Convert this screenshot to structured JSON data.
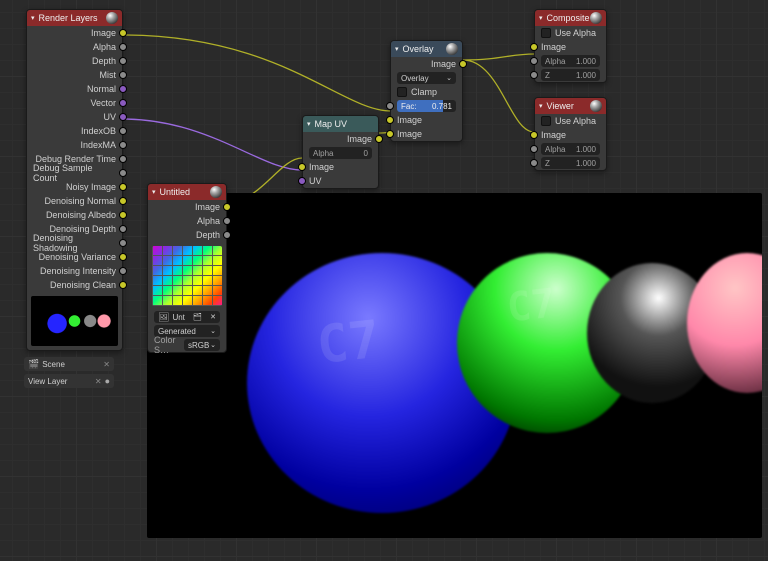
{
  "render_layers": {
    "title": "Render Layers",
    "outputs": [
      "Image",
      "Alpha",
      "Depth",
      "Mist",
      "Normal",
      "Vector",
      "UV",
      "IndexOB",
      "IndexMA",
      "Debug Render Time",
      "Debug Sample Count",
      "Noisy Image",
      "Denoising Normal",
      "Denoising Albedo",
      "Denoising Depth",
      "Denoising Shadowing",
      "Denoising Variance",
      "Denoising Intensity",
      "Denoising Clean"
    ],
    "scene_selector": {
      "icon": "scene-icon",
      "label": "Scene",
      "close": "✕"
    },
    "layer_selector": {
      "label": "View Layer",
      "close": "✕",
      "pin": "●"
    }
  },
  "image_node": {
    "title": "Untitled",
    "outputs": [
      "Image",
      "Alpha",
      "Depth"
    ],
    "image_name": "Unt",
    "source": "Generated",
    "colorspace_label": "Color S…",
    "colorspace_value": "sRGB"
  },
  "map_uv": {
    "title": "Map UV",
    "out": "Image",
    "alpha_label": "Alpha",
    "alpha_value": "0",
    "inputs": [
      "Image",
      "UV"
    ]
  },
  "overlay": {
    "title": "Overlay",
    "out": "Image",
    "blend": "Overlay",
    "clamp": "Clamp",
    "fac_label": "Fac:",
    "fac_value": "0.781",
    "inputs": [
      "Image",
      "Image"
    ]
  },
  "composite": {
    "title": "Composite",
    "use_alpha": "Use Alpha",
    "inputs": [
      {
        "name": "Image"
      },
      {
        "name": "Alpha",
        "value": "1.000"
      },
      {
        "name": "Z",
        "value": "1.000"
      }
    ]
  },
  "viewer": {
    "title": "Viewer",
    "use_alpha": "Use Alpha",
    "inputs": [
      {
        "name": "Image"
      },
      {
        "name": "Alpha",
        "value": "1.000"
      },
      {
        "name": "Z",
        "value": "1.000"
      }
    ]
  },
  "glyph": {
    "tri": "▾",
    "dd": "⌄",
    "icon_image": "🖼",
    "icon_file": "📁",
    "icon_scene": "🎬",
    "dot": "●"
  }
}
